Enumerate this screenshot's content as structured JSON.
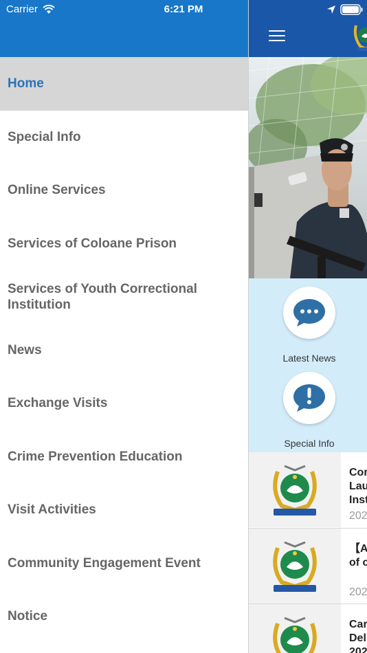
{
  "status_bar": {
    "carrier": "Carrier",
    "time": "6:21 PM"
  },
  "drawer": {
    "items": [
      {
        "label": "Home",
        "active": true
      },
      {
        "label": "Special Info"
      },
      {
        "label": "Online Services"
      },
      {
        "label": "Services of Coloane Prison"
      },
      {
        "label": "Services of Youth Correctional Institution"
      },
      {
        "label": "News"
      },
      {
        "label": "Exchange Visits"
      },
      {
        "label": "Crime Prevention Education"
      },
      {
        "label": "Visit Activities"
      },
      {
        "label": "Community Engagement Event"
      },
      {
        "label": "Notice"
      }
    ]
  },
  "main": {
    "quick_links": [
      {
        "label": "Latest News",
        "icon": "chat-bubble-icon"
      },
      {
        "label": "Special Info",
        "icon": "exclamation-bubble-icon"
      }
    ],
    "news": [
      {
        "title": "Cor\nLau\nInst",
        "date": "202"
      },
      {
        "title": "【A\nof c",
        "date": "202"
      },
      {
        "title": "Car\nDel\n202",
        "date": ""
      }
    ]
  },
  "colors": {
    "drawer_header": "#1877c9",
    "navbar": "#1a57a8",
    "active_item_bg": "#d6d6d6",
    "active_item_text": "#2a73b6",
    "menu_text": "#666666",
    "quick_links_bg": "#d3ecfa",
    "icon_blue": "#2e6fa5"
  }
}
